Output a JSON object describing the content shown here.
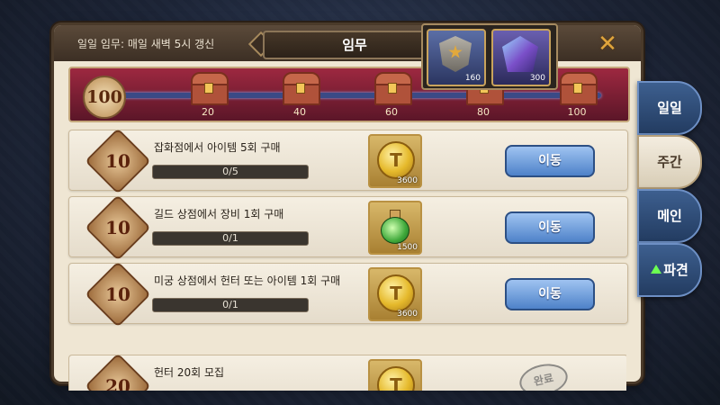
{
  "header": {
    "daily_note": "일일 임무: 매일 새벽 5시 갱신",
    "title": "임무"
  },
  "progress": {
    "points": "100",
    "fill": 0.0,
    "milestones": [
      "20",
      "40",
      "60",
      "80",
      "100"
    ]
  },
  "reward_popup": {
    "items": [
      {
        "icon": "emblem-icon",
        "count": "160"
      },
      {
        "icon": "gem-icon",
        "count": "300"
      }
    ]
  },
  "side_tabs": [
    {
      "label": "일일",
      "active": false
    },
    {
      "label": "주간",
      "active": true
    },
    {
      "label": "메인",
      "active": false
    },
    {
      "label": "파견",
      "active": false,
      "alert": true
    }
  ],
  "quests": [
    {
      "points": "10",
      "title": "잡화점에서 아이템 5회 구매",
      "progress": "0/5",
      "reward_icon": "coin-icon",
      "reward_count": "3600",
      "action": "이동"
    },
    {
      "points": "10",
      "title": "길드 상점에서 장비 1회 구매",
      "progress": "0/1",
      "reward_icon": "potion-icon",
      "reward_count": "1500",
      "action": "이동"
    },
    {
      "points": "10",
      "title": "미궁 상점에서 헌터 또는 아이템 1회 구매",
      "progress": "0/1",
      "reward_icon": "coin-icon",
      "reward_count": "3600",
      "action": "이동"
    },
    {
      "points": "20",
      "title": "헌터 20회 모집",
      "reward_icon": "coin-icon",
      "action": "완료"
    }
  ],
  "colors": {
    "accent_blue": "#4e82c9",
    "panel": "#efe6d3",
    "strip_red": "#9d2840"
  }
}
